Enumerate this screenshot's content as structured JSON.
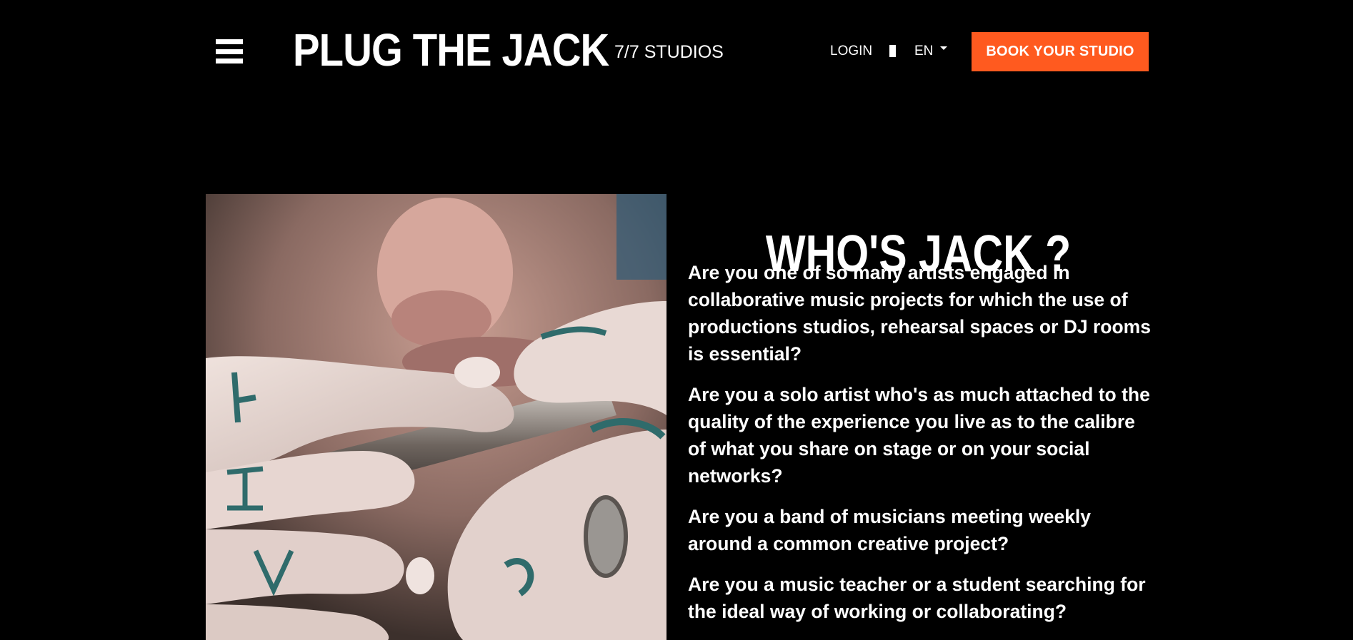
{
  "header": {
    "logo": "PLUG THE JACK",
    "studios": "7/7 STUDIOS",
    "login": "LOGIN",
    "language": "EN",
    "book_button": "BOOK YOUR STUDIO"
  },
  "main": {
    "heading": "WHO'S JACK ?",
    "paragraphs": [
      "Are you one of so many artists engaged in collaborative music projects for which the use of productions studios, rehearsal spaces or DJ rooms is essential?",
      "Are you a solo artist who's as much attached to the quality of the experience you live as to the calibre of what you share on stage or on your social networks?",
      "Are you a band of musicians meeting weekly around a common creative project?",
      "Are you a music teacher or a student searching for the ideal way of working or collaborating?"
    ]
  },
  "colors": {
    "background": "#000000",
    "text": "#ffffff",
    "accent": "#ff5a1f"
  },
  "icons": {
    "menu": "hamburger-menu-icon",
    "language_dropdown": "chevron-down-icon"
  }
}
